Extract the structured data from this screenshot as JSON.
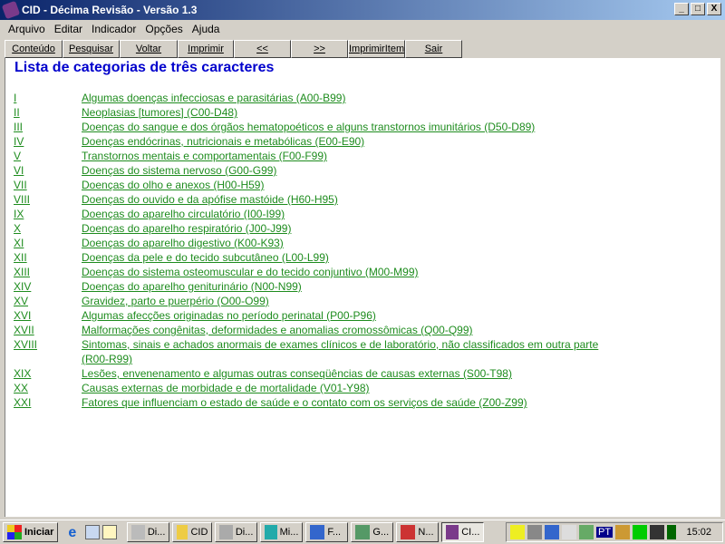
{
  "window": {
    "title": "CID - Décima Revisão - Versão 1.3",
    "controls": [
      "_",
      "□",
      "X"
    ]
  },
  "menu": [
    "Arquivo",
    "Editar",
    "Indicador",
    "Opções",
    "Ajuda"
  ],
  "toolbar": [
    "Conteúdo",
    "Pesquisar",
    "Voltar",
    "Imprimir",
    "<<",
    ">>",
    "ImprimirItem",
    "Sair"
  ],
  "page": {
    "title": "Lista de categorias de três caracteres",
    "link_color": "#1e8c1e",
    "title_color": "#0000cc",
    "chapters": [
      {
        "num": "I",
        "desc": "Algumas doenças infecciosas e parasitárias (A00-B99)"
      },
      {
        "num": "II",
        "desc": "Neoplasias [tumores] (C00-D48)"
      },
      {
        "num": "III",
        "desc": "Doenças do sangue e dos órgãos hematopoéticos e alguns transtornos imunitários (D50-D89)"
      },
      {
        "num": "IV",
        "desc": "Doenças endócrinas, nutricionais e metabólicas (E00-E90)"
      },
      {
        "num": "V",
        "desc": "Transtornos mentais e comportamentais (F00-F99)"
      },
      {
        "num": "VI",
        "desc": "Doenças do sistema nervoso (G00-G99)"
      },
      {
        "num": "VII",
        "desc": "Doenças do olho e anexos (H00-H59)"
      },
      {
        "num": "VIII",
        "desc": "Doenças do ouvido e da apófise mastóide (H60-H95)"
      },
      {
        "num": "IX",
        "desc": "Doenças do aparelho circulatório (I00-I99)"
      },
      {
        "num": "X",
        "desc": "Doenças do aparelho respiratório (J00-J99)"
      },
      {
        "num": "XI",
        "desc": "Doenças do aparelho digestivo (K00-K93)"
      },
      {
        "num": "XII",
        "desc": "Doenças da pele e do tecido subcutâneo (L00-L99)"
      },
      {
        "num": "XIII",
        "desc": "Doenças do sistema osteomuscular e do tecido conjuntivo (M00-M99)"
      },
      {
        "num": "XIV",
        "desc": "Doenças do aparelho geniturinário (N00-N99)"
      },
      {
        "num": "XV",
        "desc": "Gravidez, parto e puerpério (O00-O99)"
      },
      {
        "num": "XVI",
        "desc": "Algumas afecções originadas no período perinatal (P00-P96)"
      },
      {
        "num": "XVII",
        "desc": "Malformações congênitas, deformidades e anomalias cromossômicas (Q00-Q99)"
      },
      {
        "num": "XVIII",
        "desc": "Sintomas, sinais e achados anormais de exames clínicos e de laboratório, não classificados em outra parte",
        "desc2": "(R00-R99)"
      },
      {
        "num": "XIX",
        "desc": "Lesões, envenenamento e algumas outras conseqüências de causas externas (S00-T98)"
      },
      {
        "num": "XX",
        "desc": "Causas externas de morbidade e de mortalidade (V01-Y98)"
      },
      {
        "num": "XXI",
        "desc": "Fatores que influenciam o estado de saúde e o contato com os serviços de saúde (Z00-Z99)"
      }
    ]
  },
  "taskbar": {
    "start": "Iniciar",
    "tasks": [
      "Di...",
      "CID",
      "Di...",
      "Mi...",
      "F...",
      "G...",
      "N...",
      "CI..."
    ],
    "tray_lang": "PT",
    "clock": "15:02"
  }
}
